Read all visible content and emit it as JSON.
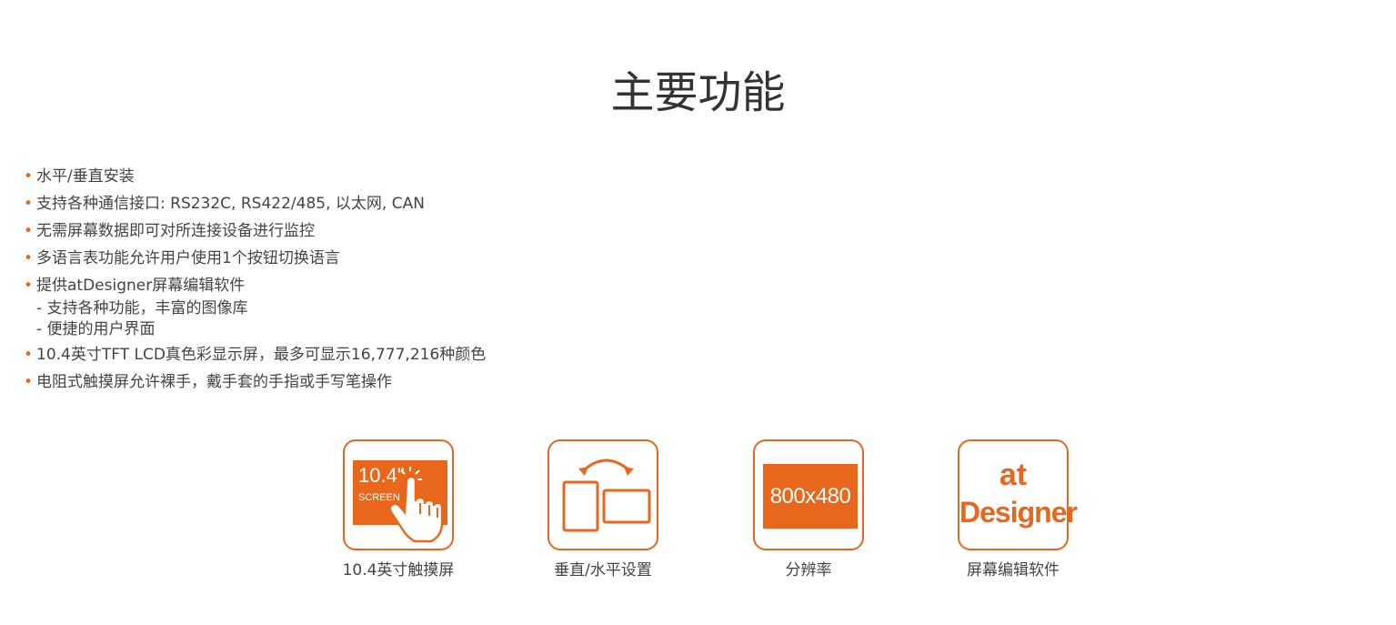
{
  "section": {
    "title": "主要功能"
  },
  "features": [
    {
      "text": "水平/垂直安装"
    },
    {
      "text": "支持各种通信接口: RS232C, RS422/485, 以太网, CAN"
    },
    {
      "text": "无需屏幕数据即可对所连接设备进行监控"
    },
    {
      "text": "多语言表功能允许用户使用1个按钮切换语言"
    },
    {
      "text": "提供atDesigner屏幕编辑软件",
      "sub": [
        "- 支持各种功能，丰富的图像库",
        "- 便捷的用户界面"
      ]
    },
    {
      "text": "10.4英寸TFT LCD真色彩显示屏，最多可显示16,777,216种颜色"
    },
    {
      "text": "电阻式触摸屏允许裸手，戴手套的手指或手写笔操作"
    }
  ],
  "icons": [
    {
      "caption": "10.4英寸触摸屏",
      "icon": "touchscreen-icon",
      "line1": "10.4\"",
      "line2": "SCREEN"
    },
    {
      "caption": "垂直/水平设置",
      "icon": "rotate-orientation-icon"
    },
    {
      "caption": "分辨率",
      "icon": "resolution-icon",
      "label": "800x480"
    },
    {
      "caption": "屏幕编辑软件",
      "icon": "atdesigner-icon",
      "line1": "at",
      "line2": "Designer"
    }
  ],
  "colors": {
    "accent": "#e8671c",
    "text": "#444444",
    "title": "#333333"
  }
}
